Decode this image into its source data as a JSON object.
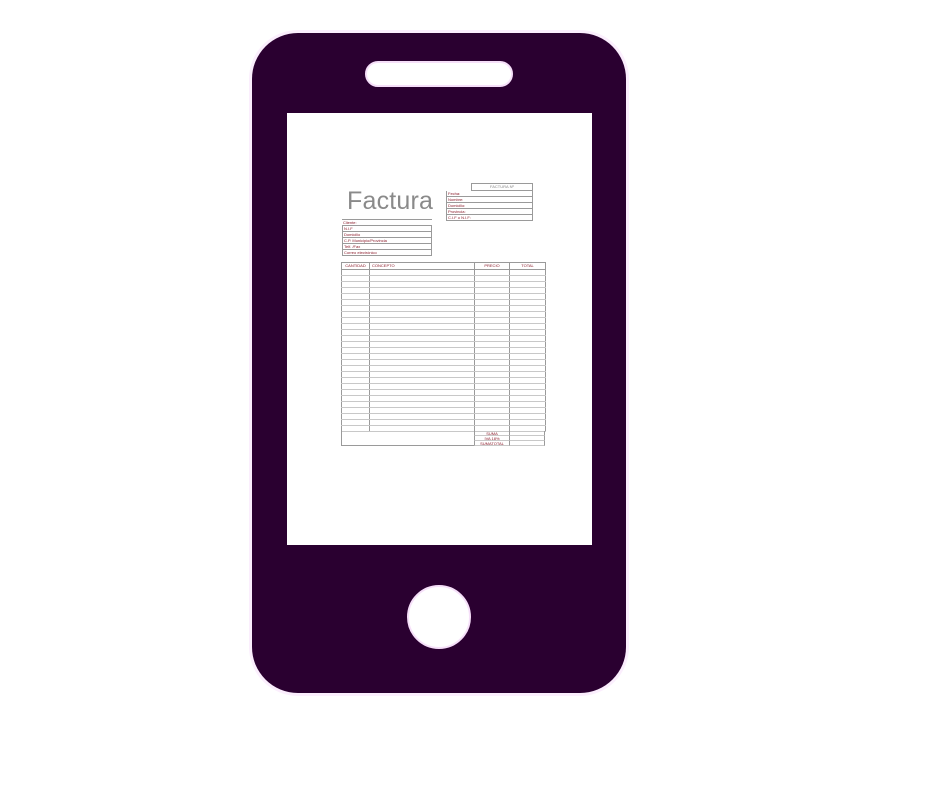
{
  "invoice": {
    "title": "Factura",
    "number_label": "FACTURA Nº",
    "issuer_rows": [
      "Fecha:",
      "Nombre:",
      "Domicilio:",
      "Provincia:",
      "C.I.F o N.I.F:"
    ],
    "client_rows": [
      "Cliente:",
      "N.I.F",
      "Domicilio",
      "C.P. Municipio/Provincia",
      "Telf. /Fax",
      "Correo electrónico"
    ],
    "columns": [
      "CANTIDAD",
      "CONCEPTO",
      "PRECIO",
      "TOTAL"
    ],
    "totals": [
      "SUMA",
      "IVA 18%",
      "SUMATOTAL"
    ]
  },
  "colors": {
    "phone_body": "#2a0030",
    "screen": "#ffffff",
    "accent_text": "#8b1b2a"
  },
  "icons": {
    "device": "smartphone-icon",
    "home": "home-button-icon"
  }
}
